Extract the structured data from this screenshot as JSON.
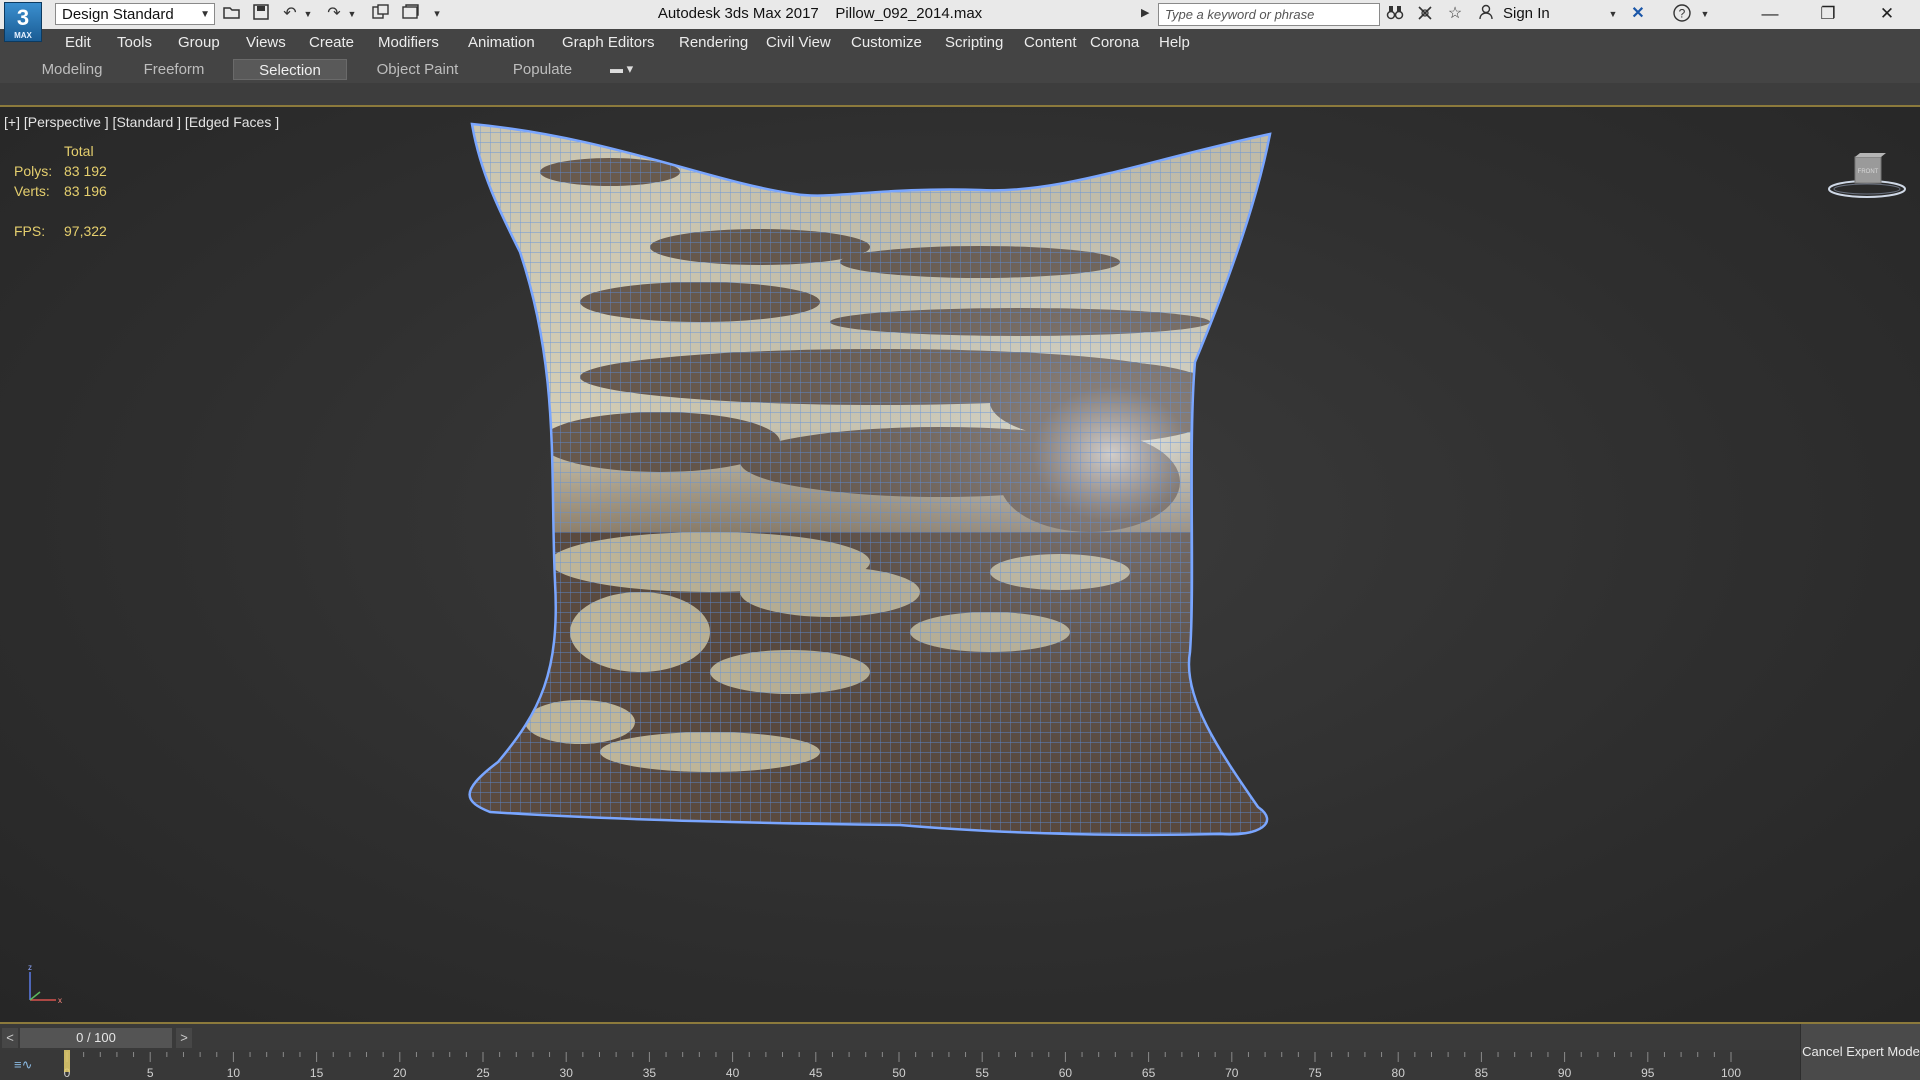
{
  "titlebar": {
    "logo": {
      "big": "3",
      "small": "MAX"
    },
    "workspace": "Design Standard",
    "app_title": "Autodesk 3ds Max 2017",
    "file_name": "Pillow_092_2014.max",
    "search_placeholder": "Type a keyword or phrase",
    "sign_in": "Sign In",
    "quick_access_icons": [
      "open-icon",
      "save-icon",
      "undo-icon",
      "redo-icon",
      "hold-icon",
      "fetch-icon",
      "customize-icon"
    ],
    "window_controls": {
      "minimize": "—",
      "restore": "❐",
      "close": "✕"
    }
  },
  "menu": [
    "Edit",
    "Tools",
    "Group",
    "Views",
    "Create",
    "Modifiers",
    "Animation",
    "Graph Editors",
    "Rendering",
    "Civil View",
    "Customize",
    "Scripting",
    "Content",
    "Corona",
    "Help"
  ],
  "ribbon": {
    "tabs": [
      "Modeling",
      "Freeform",
      "Selection",
      "Object Paint",
      "Populate"
    ],
    "active_tab": "Selection"
  },
  "viewport": {
    "label": "[+] [Perspective ] [Standard ] [Edged Faces ]",
    "stats": {
      "header": "Total",
      "polys_label": "Polys:",
      "polys": "83 192",
      "verts_label": "Verts:",
      "verts": "83 196",
      "fps_label": "FPS:",
      "fps": "97,322"
    },
    "viewcube_face": "FRONT"
  },
  "timeline": {
    "prev": "<",
    "next": ">",
    "frame": "0 / 100",
    "ticks": [
      0,
      5,
      10,
      15,
      20,
      25,
      30,
      35,
      40,
      45,
      50,
      55,
      60,
      65,
      70,
      75,
      80,
      85,
      90,
      95,
      100
    ],
    "cancel_expert_mode": "Cancel Expert Mode"
  },
  "colors": {
    "stats_text": "#e5cf6e",
    "wireframe": "#5b8fe0",
    "ui_dark": "#444444",
    "accent_border": "#8c7a3c"
  }
}
